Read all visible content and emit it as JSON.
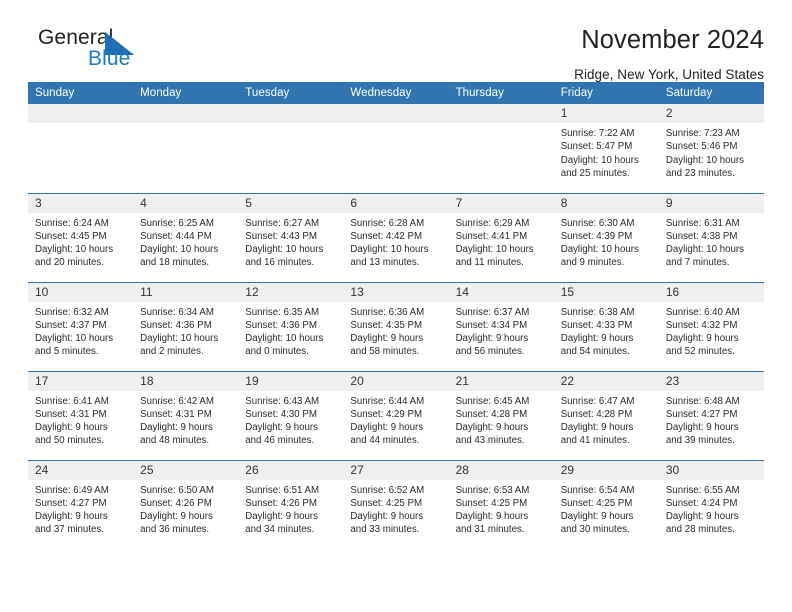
{
  "logo": {
    "word_one": "General",
    "word_two": "Blue",
    "triangle_color": "#1f6fb5"
  },
  "header": {
    "title": "November 2024",
    "location": "Ridge, New York, United States"
  },
  "theme": {
    "header_blue": "#3175b0",
    "daynum_gray": "#efefef",
    "logo_blue": "#1f7bc1"
  },
  "weekday_headers": [
    "Sunday",
    "Monday",
    "Tuesday",
    "Wednesday",
    "Thursday",
    "Friday",
    "Saturday"
  ],
  "weeks": [
    [
      {
        "day": "",
        "empty": true
      },
      {
        "day": "",
        "empty": true
      },
      {
        "day": "",
        "empty": true
      },
      {
        "day": "",
        "empty": true
      },
      {
        "day": "",
        "empty": true
      },
      {
        "day": "1",
        "sunrise": "Sunrise: 7:22 AM",
        "sunset": "Sunset: 5:47 PM",
        "daylight_line1": "Daylight: 10 hours",
        "daylight_line2": "and 25 minutes."
      },
      {
        "day": "2",
        "sunrise": "Sunrise: 7:23 AM",
        "sunset": "Sunset: 5:46 PM",
        "daylight_line1": "Daylight: 10 hours",
        "daylight_line2": "and 23 minutes."
      }
    ],
    [
      {
        "day": "3",
        "sunrise": "Sunrise: 6:24 AM",
        "sunset": "Sunset: 4:45 PM",
        "daylight_line1": "Daylight: 10 hours",
        "daylight_line2": "and 20 minutes."
      },
      {
        "day": "4",
        "sunrise": "Sunrise: 6:25 AM",
        "sunset": "Sunset: 4:44 PM",
        "daylight_line1": "Daylight: 10 hours",
        "daylight_line2": "and 18 minutes."
      },
      {
        "day": "5",
        "sunrise": "Sunrise: 6:27 AM",
        "sunset": "Sunset: 4:43 PM",
        "daylight_line1": "Daylight: 10 hours",
        "daylight_line2": "and 16 minutes."
      },
      {
        "day": "6",
        "sunrise": "Sunrise: 6:28 AM",
        "sunset": "Sunset: 4:42 PM",
        "daylight_line1": "Daylight: 10 hours",
        "daylight_line2": "and 13 minutes."
      },
      {
        "day": "7",
        "sunrise": "Sunrise: 6:29 AM",
        "sunset": "Sunset: 4:41 PM",
        "daylight_line1": "Daylight: 10 hours",
        "daylight_line2": "and 11 minutes."
      },
      {
        "day": "8",
        "sunrise": "Sunrise: 6:30 AM",
        "sunset": "Sunset: 4:39 PM",
        "daylight_line1": "Daylight: 10 hours",
        "daylight_line2": "and 9 minutes."
      },
      {
        "day": "9",
        "sunrise": "Sunrise: 6:31 AM",
        "sunset": "Sunset: 4:38 PM",
        "daylight_line1": "Daylight: 10 hours",
        "daylight_line2": "and 7 minutes."
      }
    ],
    [
      {
        "day": "10",
        "sunrise": "Sunrise: 6:32 AM",
        "sunset": "Sunset: 4:37 PM",
        "daylight_line1": "Daylight: 10 hours",
        "daylight_line2": "and 5 minutes."
      },
      {
        "day": "11",
        "sunrise": "Sunrise: 6:34 AM",
        "sunset": "Sunset: 4:36 PM",
        "daylight_line1": "Daylight: 10 hours",
        "daylight_line2": "and 2 minutes."
      },
      {
        "day": "12",
        "sunrise": "Sunrise: 6:35 AM",
        "sunset": "Sunset: 4:36 PM",
        "daylight_line1": "Daylight: 10 hours",
        "daylight_line2": "and 0 minutes."
      },
      {
        "day": "13",
        "sunrise": "Sunrise: 6:36 AM",
        "sunset": "Sunset: 4:35 PM",
        "daylight_line1": "Daylight: 9 hours",
        "daylight_line2": "and 58 minutes."
      },
      {
        "day": "14",
        "sunrise": "Sunrise: 6:37 AM",
        "sunset": "Sunset: 4:34 PM",
        "daylight_line1": "Daylight: 9 hours",
        "daylight_line2": "and 56 minutes."
      },
      {
        "day": "15",
        "sunrise": "Sunrise: 6:38 AM",
        "sunset": "Sunset: 4:33 PM",
        "daylight_line1": "Daylight: 9 hours",
        "daylight_line2": "and 54 minutes."
      },
      {
        "day": "16",
        "sunrise": "Sunrise: 6:40 AM",
        "sunset": "Sunset: 4:32 PM",
        "daylight_line1": "Daylight: 9 hours",
        "daylight_line2": "and 52 minutes."
      }
    ],
    [
      {
        "day": "17",
        "sunrise": "Sunrise: 6:41 AM",
        "sunset": "Sunset: 4:31 PM",
        "daylight_line1": "Daylight: 9 hours",
        "daylight_line2": "and 50 minutes."
      },
      {
        "day": "18",
        "sunrise": "Sunrise: 6:42 AM",
        "sunset": "Sunset: 4:31 PM",
        "daylight_line1": "Daylight: 9 hours",
        "daylight_line2": "and 48 minutes."
      },
      {
        "day": "19",
        "sunrise": "Sunrise: 6:43 AM",
        "sunset": "Sunset: 4:30 PM",
        "daylight_line1": "Daylight: 9 hours",
        "daylight_line2": "and 46 minutes."
      },
      {
        "day": "20",
        "sunrise": "Sunrise: 6:44 AM",
        "sunset": "Sunset: 4:29 PM",
        "daylight_line1": "Daylight: 9 hours",
        "daylight_line2": "and 44 minutes."
      },
      {
        "day": "21",
        "sunrise": "Sunrise: 6:45 AM",
        "sunset": "Sunset: 4:28 PM",
        "daylight_line1": "Daylight: 9 hours",
        "daylight_line2": "and 43 minutes."
      },
      {
        "day": "22",
        "sunrise": "Sunrise: 6:47 AM",
        "sunset": "Sunset: 4:28 PM",
        "daylight_line1": "Daylight: 9 hours",
        "daylight_line2": "and 41 minutes."
      },
      {
        "day": "23",
        "sunrise": "Sunrise: 6:48 AM",
        "sunset": "Sunset: 4:27 PM",
        "daylight_line1": "Daylight: 9 hours",
        "daylight_line2": "and 39 minutes."
      }
    ],
    [
      {
        "day": "24",
        "sunrise": "Sunrise: 6:49 AM",
        "sunset": "Sunset: 4:27 PM",
        "daylight_line1": "Daylight: 9 hours",
        "daylight_line2": "and 37 minutes."
      },
      {
        "day": "25",
        "sunrise": "Sunrise: 6:50 AM",
        "sunset": "Sunset: 4:26 PM",
        "daylight_line1": "Daylight: 9 hours",
        "daylight_line2": "and 36 minutes."
      },
      {
        "day": "26",
        "sunrise": "Sunrise: 6:51 AM",
        "sunset": "Sunset: 4:26 PM",
        "daylight_line1": "Daylight: 9 hours",
        "daylight_line2": "and 34 minutes."
      },
      {
        "day": "27",
        "sunrise": "Sunrise: 6:52 AM",
        "sunset": "Sunset: 4:25 PM",
        "daylight_line1": "Daylight: 9 hours",
        "daylight_line2": "and 33 minutes."
      },
      {
        "day": "28",
        "sunrise": "Sunrise: 6:53 AM",
        "sunset": "Sunset: 4:25 PM",
        "daylight_line1": "Daylight: 9 hours",
        "daylight_line2": "and 31 minutes."
      },
      {
        "day": "29",
        "sunrise": "Sunrise: 6:54 AM",
        "sunset": "Sunset: 4:25 PM",
        "daylight_line1": "Daylight: 9 hours",
        "daylight_line2": "and 30 minutes."
      },
      {
        "day": "30",
        "sunrise": "Sunrise: 6:55 AM",
        "sunset": "Sunset: 4:24 PM",
        "daylight_line1": "Daylight: 9 hours",
        "daylight_line2": "and 28 minutes."
      }
    ]
  ]
}
